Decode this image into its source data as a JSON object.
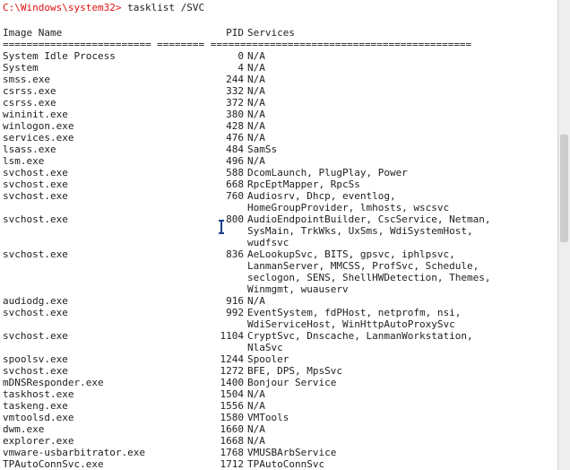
{
  "console": {
    "prompt": "C:\\Windows\\system32>",
    "command": " tasklist /SVC",
    "header": {
      "name": "Image Name",
      "pid": "PID",
      "services": "Services"
    },
    "separator": "========================= ======== ============================================",
    "rows": [
      {
        "name": "System Idle Process",
        "pid": "0",
        "services": [
          "N/A"
        ]
      },
      {
        "name": "System",
        "pid": "4",
        "services": [
          "N/A"
        ]
      },
      {
        "name": "smss.exe",
        "pid": "244",
        "services": [
          "N/A"
        ]
      },
      {
        "name": "csrss.exe",
        "pid": "332",
        "services": [
          "N/A"
        ]
      },
      {
        "name": "csrss.exe",
        "pid": "372",
        "services": [
          "N/A"
        ]
      },
      {
        "name": "wininit.exe",
        "pid": "380",
        "services": [
          "N/A"
        ]
      },
      {
        "name": "winlogon.exe",
        "pid": "428",
        "services": [
          "N/A"
        ]
      },
      {
        "name": "services.exe",
        "pid": "476",
        "services": [
          "N/A"
        ]
      },
      {
        "name": "lsass.exe",
        "pid": "484",
        "services": [
          "SamSs"
        ]
      },
      {
        "name": "lsm.exe",
        "pid": "496",
        "services": [
          "N/A"
        ]
      },
      {
        "name": "svchost.exe",
        "pid": "588",
        "services": [
          "DcomLaunch, PlugPlay, Power"
        ]
      },
      {
        "name": "svchost.exe",
        "pid": "668",
        "services": [
          "RpcEptMapper, RpcSs"
        ]
      },
      {
        "name": "svchost.exe",
        "pid": "760",
        "services": [
          "Audiosrv, Dhcp, eventlog,",
          "HomeGroupProvider, lmhosts, wscsvc"
        ]
      },
      {
        "name": "svchost.exe",
        "pid": "800",
        "services": [
          "AudioEndpointBuilder, CscService, Netman,",
          "SysMain, TrkWks, UxSms, WdiSystemHost,",
          "wudfsvc"
        ]
      },
      {
        "name": "svchost.exe",
        "pid": "836",
        "services": [
          "AeLookupSvc, BITS, gpsvc, iphlpsvc,",
          "LanmanServer, MMCSS, ProfSvc, Schedule,",
          "seclogon, SENS, ShellHWDetection, Themes,",
          "Winmgmt, wuauserv"
        ]
      },
      {
        "name": "audiodg.exe",
        "pid": "916",
        "services": [
          "N/A"
        ]
      },
      {
        "name": "svchost.exe",
        "pid": "992",
        "services": [
          "EventSystem, fdPHost, netprofm, nsi,",
          "WdiServiceHost, WinHttpAutoProxySvc"
        ]
      },
      {
        "name": "svchost.exe",
        "pid": "1104",
        "services": [
          "CryptSvc, Dnscache, LanmanWorkstation,",
          "NlaSvc"
        ]
      },
      {
        "name": "spoolsv.exe",
        "pid": "1244",
        "services": [
          "Spooler"
        ]
      },
      {
        "name": "svchost.exe",
        "pid": "1272",
        "services": [
          "BFE, DPS, MpsSvc"
        ]
      },
      {
        "name": "mDNSResponder.exe",
        "pid": "1400",
        "services": [
          "Bonjour Service"
        ]
      },
      {
        "name": "taskhost.exe",
        "pid": "1504",
        "services": [
          "N/A"
        ]
      },
      {
        "name": "taskeng.exe",
        "pid": "1556",
        "services": [
          "N/A"
        ]
      },
      {
        "name": "vmtoolsd.exe",
        "pid": "1580",
        "services": [
          "VMTools"
        ]
      },
      {
        "name": "dwm.exe",
        "pid": "1660",
        "services": [
          "N/A"
        ]
      },
      {
        "name": "explorer.exe",
        "pid": "1668",
        "services": [
          "N/A"
        ]
      },
      {
        "name": "vmware-usbarbitrator.exe",
        "pid": "1768",
        "services": [
          "VMUSBArbService"
        ]
      },
      {
        "name": "TPAutoConnSvc.exe",
        "pid": "1712",
        "services": [
          "TPAutoConnSvc"
        ]
      }
    ]
  },
  "colors": {
    "prompt": "#e01010",
    "text": "#1e1e1e",
    "background": "#ffffff"
  },
  "icons": {
    "cursor": "ibeam-cursor-icon"
  }
}
